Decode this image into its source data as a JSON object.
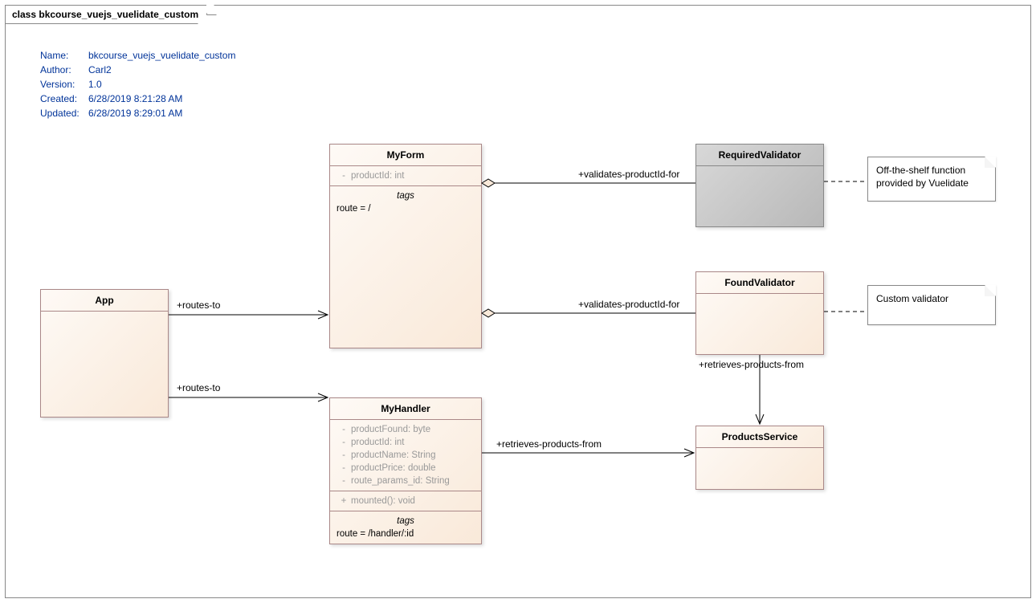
{
  "frame": {
    "title": "class bkcourse_vuejs_vuelidate_custom"
  },
  "meta": {
    "rows": [
      {
        "label": "Name:",
        "value": "bkcourse_vuejs_vuelidate_custom"
      },
      {
        "label": "Author:",
        "value": "Carl2"
      },
      {
        "label": "Version:",
        "value": "1.0"
      },
      {
        "label": "Created:",
        "value": "6/28/2019 8:21:28 AM"
      },
      {
        "label": "Updated:",
        "value": "6/28/2019 8:29:01 AM"
      }
    ]
  },
  "classes": {
    "app": {
      "title": "App"
    },
    "myform": {
      "title": "MyForm",
      "attrs": [
        {
          "vis": "-",
          "text": "productId: int"
        }
      ],
      "tags_heading": "tags",
      "tags_line": "route = /"
    },
    "myhandler": {
      "title": "MyHandler",
      "attrs": [
        {
          "vis": "-",
          "text": "productFound: byte"
        },
        {
          "vis": "-",
          "text": "productId: int"
        },
        {
          "vis": "-",
          "text": "productName: String"
        },
        {
          "vis": "-",
          "text": "productPrice: double"
        },
        {
          "vis": "-",
          "text": "route_params_id: String"
        }
      ],
      "ops": [
        {
          "vis": "+",
          "text": "mounted(): void"
        }
      ],
      "tags_heading": "tags",
      "tags_line": "route = /handler/:id"
    },
    "requiredvalidator": {
      "title": "RequiredValidator"
    },
    "foundvalidator": {
      "title": "FoundValidator"
    },
    "productsservice": {
      "title": "ProductsService"
    }
  },
  "notes": {
    "note1": {
      "line1": "Off-the-shelf function",
      "line2": "provided by Vuelidate"
    },
    "note2": {
      "line1": "Custom validator"
    }
  },
  "edges": {
    "app_myform": "+routes-to",
    "app_myhandler": "+routes-to",
    "myform_required": "+validates-productId-for",
    "myform_found": "+validates-productId-for",
    "myhandler_products": "+retrieves-products-from",
    "found_products": "+retrieves-products-from"
  },
  "chart_data": {
    "type": "uml-class-diagram",
    "title": "class bkcourse_vuejs_vuelidate_custom",
    "classes": [
      {
        "name": "App",
        "attributes": [],
        "operations": [],
        "tags": {}
      },
      {
        "name": "MyForm",
        "attributes": [
          {
            "visibility": "-",
            "name": "productId",
            "type": "int"
          }
        ],
        "operations": [],
        "tags": {
          "route": "/"
        }
      },
      {
        "name": "MyHandler",
        "attributes": [
          {
            "visibility": "-",
            "name": "productFound",
            "type": "byte"
          },
          {
            "visibility": "-",
            "name": "productId",
            "type": "int"
          },
          {
            "visibility": "-",
            "name": "productName",
            "type": "String"
          },
          {
            "visibility": "-",
            "name": "productPrice",
            "type": "double"
          },
          {
            "visibility": "-",
            "name": "route_params_id",
            "type": "String"
          }
        ],
        "operations": [
          {
            "visibility": "+",
            "name": "mounted",
            "return": "void"
          }
        ],
        "tags": {
          "route": "/handler/:id"
        }
      },
      {
        "name": "RequiredValidator",
        "attributes": [],
        "operations": [],
        "tags": {},
        "note": "Off-the-shelf function provided by Vuelidate"
      },
      {
        "name": "FoundValidator",
        "attributes": [],
        "operations": [],
        "tags": {},
        "note": "Custom validator"
      },
      {
        "name": "ProductsService",
        "attributes": [],
        "operations": [],
        "tags": {}
      }
    ],
    "relationships": [
      {
        "from": "App",
        "to": "MyForm",
        "type": "association-open-arrow",
        "label": "+routes-to"
      },
      {
        "from": "App",
        "to": "MyHandler",
        "type": "association-open-arrow",
        "label": "+routes-to"
      },
      {
        "from": "RequiredValidator",
        "to": "MyForm",
        "type": "aggregation",
        "label": "+validates-productId-for"
      },
      {
        "from": "FoundValidator",
        "to": "MyForm",
        "type": "aggregation",
        "label": "+validates-productId-for"
      },
      {
        "from": "MyHandler",
        "to": "ProductsService",
        "type": "association-open-arrow",
        "label": "+retrieves-products-from"
      },
      {
        "from": "FoundValidator",
        "to": "ProductsService",
        "type": "association-open-arrow",
        "label": "+retrieves-products-from"
      },
      {
        "from": "RequiredValidator",
        "to": "Note1",
        "type": "note-anchor"
      },
      {
        "from": "FoundValidator",
        "to": "Note2",
        "type": "note-anchor"
      }
    ]
  }
}
